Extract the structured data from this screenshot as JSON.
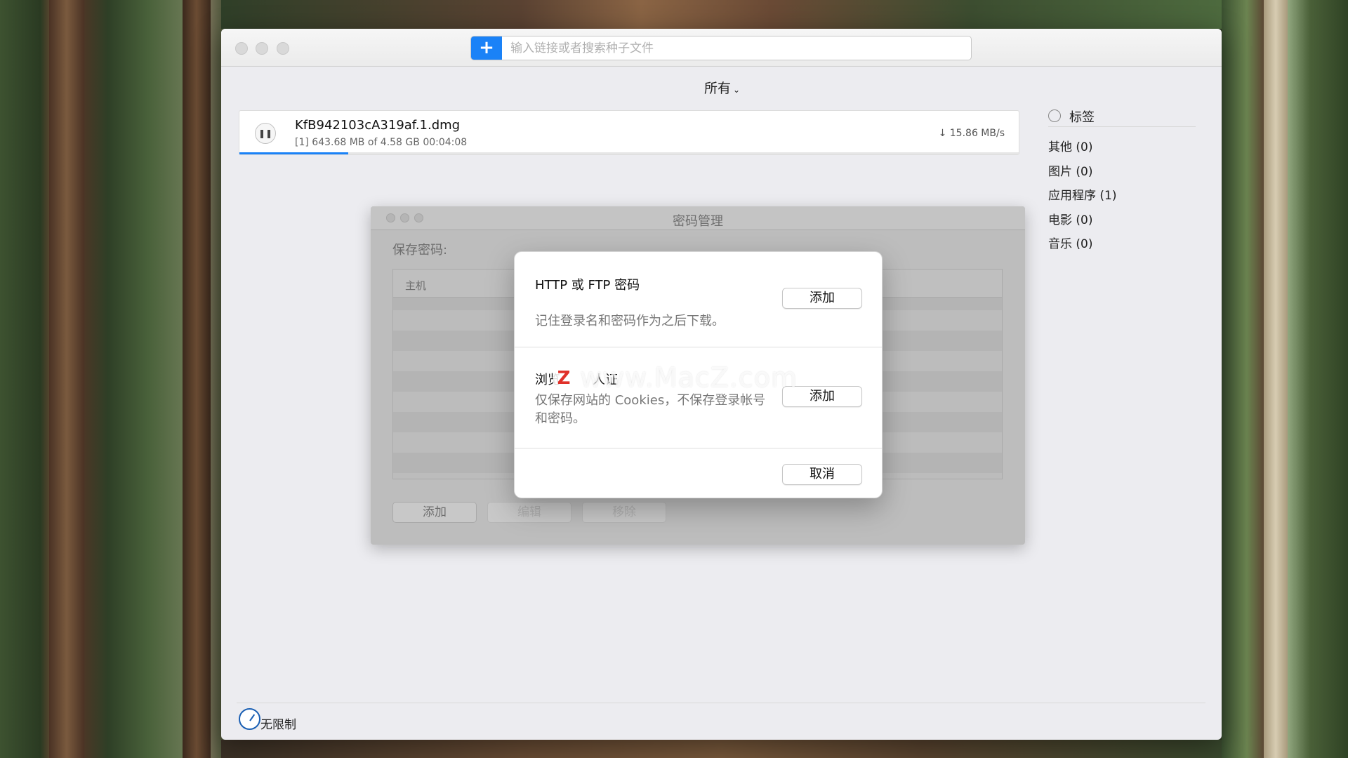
{
  "toolbar": {
    "add_icon": "+",
    "search_placeholder": "输入链接或者搜索种子文件"
  },
  "filter": {
    "label": "所有",
    "chevron": "⌄"
  },
  "download": {
    "name": "KfB942103cA319af.1.dmg",
    "meta": "[1] 643.68 MB of 4.58 GB  00:04:08",
    "speed": "↓ 15.86 MB/s",
    "progress_fraction": 0.14,
    "pause_icon": "❚❚"
  },
  "sidebar": {
    "tag_header": "标签",
    "items": [
      {
        "label": "其他 (0)"
      },
      {
        "label": "图片 (0)"
      },
      {
        "label": "应用程序 (1)"
      },
      {
        "label": "电影 (0)"
      },
      {
        "label": "音乐 (0)"
      }
    ]
  },
  "footer": {
    "speed_limit_label": "无限制"
  },
  "password_manager": {
    "title": "密码管理",
    "saved_label": "保存密码:",
    "column_host": "主机",
    "add_label": "添加",
    "edit_label": "编辑",
    "remove_label": "移除"
  },
  "sheet": {
    "http_title": "HTTP 或 FTP 密码",
    "http_desc": "记住登录名和密码作为之后下载。",
    "http_add_label": "添加",
    "browser_title": "浏览",
    "browser_title_suffix": "人证",
    "browser_desc": "仅保存网站的 Cookies，不保存登录帐号和密码。",
    "browser_add_label": "添加",
    "cancel_label": "取消"
  },
  "watermark": {
    "text": "www.MacZ.com",
    "logo": "Z"
  },
  "colors": {
    "accent": "#1a82f7",
    "window_bg": "#ececf0"
  }
}
